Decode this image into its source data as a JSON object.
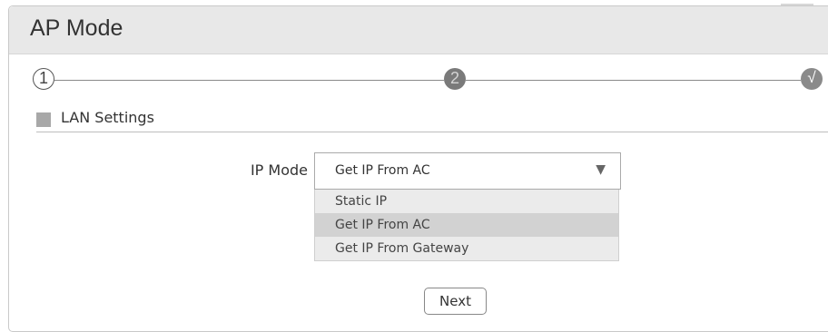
{
  "panel": {
    "title": "AP Mode"
  },
  "stepper": {
    "steps": [
      {
        "label": "1",
        "state": "current"
      },
      {
        "label": "2",
        "state": "pending"
      },
      {
        "label": "√",
        "state": "done"
      }
    ]
  },
  "section": {
    "title": "LAN Settings"
  },
  "form": {
    "ip_mode": {
      "label": "IP Mode",
      "value": "Get IP From AC",
      "arrow_icon": "▼",
      "options": [
        "Static IP",
        "Get IP From AC",
        "Get IP From Gateway"
      ]
    }
  },
  "actions": {
    "next_label": "Next"
  },
  "colors": {
    "header_bg": "#e8e8e8",
    "selected_option_bg": "#d2d2d2",
    "dropdown_bg": "#ebebeb"
  }
}
